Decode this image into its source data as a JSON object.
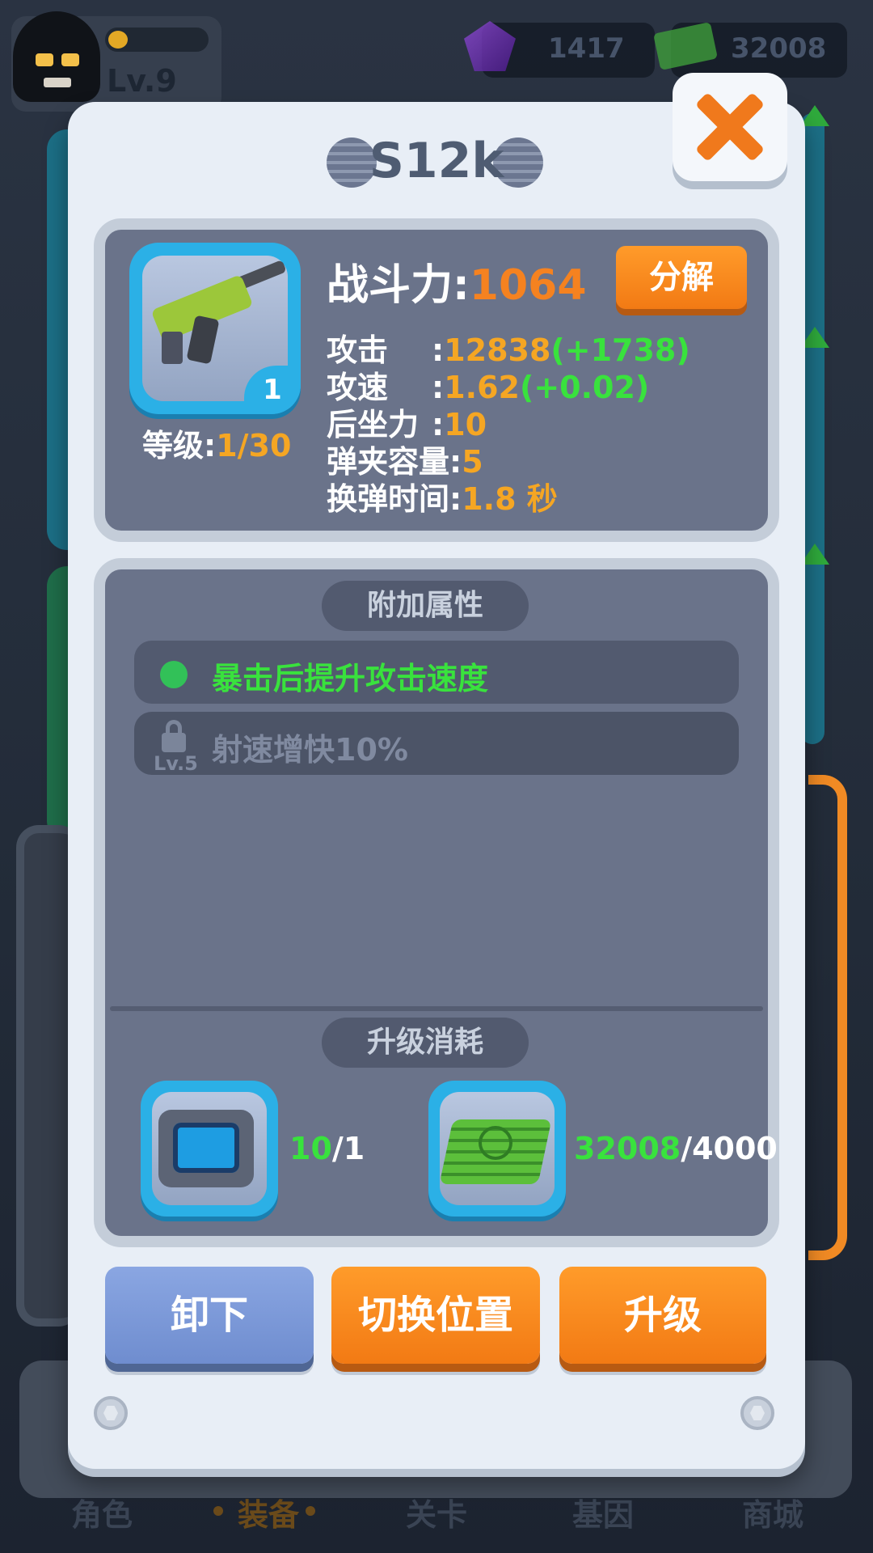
{
  "player": {
    "level_text": "Lv.9"
  },
  "resources": {
    "gems": "1417",
    "cash": "32008"
  },
  "bottom_nav": {
    "items": [
      "角色",
      "装备",
      "关卡",
      "基因",
      "商城"
    ],
    "active": "装备"
  },
  "modal": {
    "title": "S12k",
    "weapon": {
      "star_badge": "1",
      "level_label": "等级:",
      "level_value": "1/30"
    },
    "power_label": "战斗力:",
    "power_value": "1064",
    "decompose_label": "分解",
    "stats": [
      {
        "label": "攻击",
        "value": "12838",
        "bonus": "(+1738)"
      },
      {
        "label": "攻速",
        "value": "1.62",
        "bonus": "(+0.02)"
      },
      {
        "label": "后坐力",
        "value": "10",
        "bonus": ""
      },
      {
        "label": "弹夹容量",
        "value": "5",
        "bonus": ""
      },
      {
        "label": "换弹时间",
        "value": "1.8 秒",
        "bonus": ""
      }
    ],
    "extra_attrs_title": "附加属性",
    "extra_attrs": [
      {
        "text": "暴击后提升攻击速度",
        "unlocked": true
      },
      {
        "text": "射速增快10%",
        "unlocked": false,
        "lock_level": "Lv.5"
      }
    ],
    "upgrade_cost_title": "升级消耗",
    "costs": [
      {
        "icon": "chip-icon",
        "have": "10",
        "need": "/1"
      },
      {
        "icon": "cash-icon",
        "have": "32008",
        "need": "/4000"
      }
    ],
    "buttons": {
      "unequip": "卸下",
      "switch_position": "切换位置",
      "upgrade": "升级"
    }
  },
  "colors": {
    "accent_orange": "#f27a14",
    "stat_value": "#f5a623",
    "bonus_green": "#39e23d",
    "weapon_frame": "#2bb0e6",
    "unequip_blue": "#7b97d8"
  }
}
